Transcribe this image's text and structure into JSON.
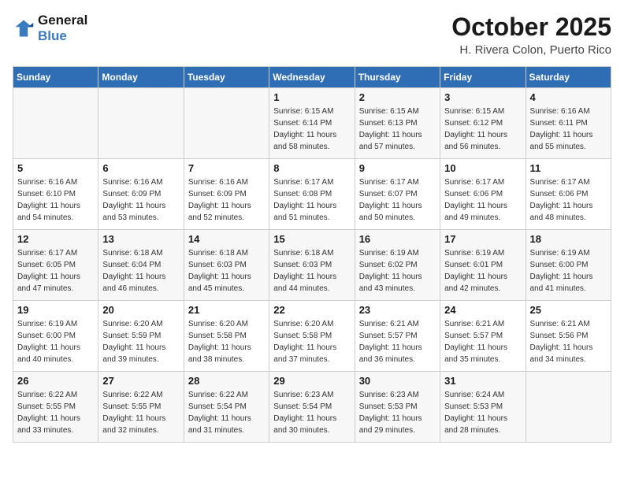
{
  "header": {
    "logo_line1": "General",
    "logo_line2": "Blue",
    "title": "October 2025",
    "subtitle": "H. Rivera Colon, Puerto Rico"
  },
  "weekdays": [
    "Sunday",
    "Monday",
    "Tuesday",
    "Wednesday",
    "Thursday",
    "Friday",
    "Saturday"
  ],
  "weeks": [
    [
      {
        "day": "",
        "sunrise": "",
        "sunset": "",
        "daylight": ""
      },
      {
        "day": "",
        "sunrise": "",
        "sunset": "",
        "daylight": ""
      },
      {
        "day": "",
        "sunrise": "",
        "sunset": "",
        "daylight": ""
      },
      {
        "day": "1",
        "sunrise": "Sunrise: 6:15 AM",
        "sunset": "Sunset: 6:14 PM",
        "daylight": "Daylight: 11 hours and 58 minutes."
      },
      {
        "day": "2",
        "sunrise": "Sunrise: 6:15 AM",
        "sunset": "Sunset: 6:13 PM",
        "daylight": "Daylight: 11 hours and 57 minutes."
      },
      {
        "day": "3",
        "sunrise": "Sunrise: 6:15 AM",
        "sunset": "Sunset: 6:12 PM",
        "daylight": "Daylight: 11 hours and 56 minutes."
      },
      {
        "day": "4",
        "sunrise": "Sunrise: 6:16 AM",
        "sunset": "Sunset: 6:11 PM",
        "daylight": "Daylight: 11 hours and 55 minutes."
      }
    ],
    [
      {
        "day": "5",
        "sunrise": "Sunrise: 6:16 AM",
        "sunset": "Sunset: 6:10 PM",
        "daylight": "Daylight: 11 hours and 54 minutes."
      },
      {
        "day": "6",
        "sunrise": "Sunrise: 6:16 AM",
        "sunset": "Sunset: 6:09 PM",
        "daylight": "Daylight: 11 hours and 53 minutes."
      },
      {
        "day": "7",
        "sunrise": "Sunrise: 6:16 AM",
        "sunset": "Sunset: 6:09 PM",
        "daylight": "Daylight: 11 hours and 52 minutes."
      },
      {
        "day": "8",
        "sunrise": "Sunrise: 6:17 AM",
        "sunset": "Sunset: 6:08 PM",
        "daylight": "Daylight: 11 hours and 51 minutes."
      },
      {
        "day": "9",
        "sunrise": "Sunrise: 6:17 AM",
        "sunset": "Sunset: 6:07 PM",
        "daylight": "Daylight: 11 hours and 50 minutes."
      },
      {
        "day": "10",
        "sunrise": "Sunrise: 6:17 AM",
        "sunset": "Sunset: 6:06 PM",
        "daylight": "Daylight: 11 hours and 49 minutes."
      },
      {
        "day": "11",
        "sunrise": "Sunrise: 6:17 AM",
        "sunset": "Sunset: 6:06 PM",
        "daylight": "Daylight: 11 hours and 48 minutes."
      }
    ],
    [
      {
        "day": "12",
        "sunrise": "Sunrise: 6:17 AM",
        "sunset": "Sunset: 6:05 PM",
        "daylight": "Daylight: 11 hours and 47 minutes."
      },
      {
        "day": "13",
        "sunrise": "Sunrise: 6:18 AM",
        "sunset": "Sunset: 6:04 PM",
        "daylight": "Daylight: 11 hours and 46 minutes."
      },
      {
        "day": "14",
        "sunrise": "Sunrise: 6:18 AM",
        "sunset": "Sunset: 6:03 PM",
        "daylight": "Daylight: 11 hours and 45 minutes."
      },
      {
        "day": "15",
        "sunrise": "Sunrise: 6:18 AM",
        "sunset": "Sunset: 6:03 PM",
        "daylight": "Daylight: 11 hours and 44 minutes."
      },
      {
        "day": "16",
        "sunrise": "Sunrise: 6:19 AM",
        "sunset": "Sunset: 6:02 PM",
        "daylight": "Daylight: 11 hours and 43 minutes."
      },
      {
        "day": "17",
        "sunrise": "Sunrise: 6:19 AM",
        "sunset": "Sunset: 6:01 PM",
        "daylight": "Daylight: 11 hours and 42 minutes."
      },
      {
        "day": "18",
        "sunrise": "Sunrise: 6:19 AM",
        "sunset": "Sunset: 6:00 PM",
        "daylight": "Daylight: 11 hours and 41 minutes."
      }
    ],
    [
      {
        "day": "19",
        "sunrise": "Sunrise: 6:19 AM",
        "sunset": "Sunset: 6:00 PM",
        "daylight": "Daylight: 11 hours and 40 minutes."
      },
      {
        "day": "20",
        "sunrise": "Sunrise: 6:20 AM",
        "sunset": "Sunset: 5:59 PM",
        "daylight": "Daylight: 11 hours and 39 minutes."
      },
      {
        "day": "21",
        "sunrise": "Sunrise: 6:20 AM",
        "sunset": "Sunset: 5:58 PM",
        "daylight": "Daylight: 11 hours and 38 minutes."
      },
      {
        "day": "22",
        "sunrise": "Sunrise: 6:20 AM",
        "sunset": "Sunset: 5:58 PM",
        "daylight": "Daylight: 11 hours and 37 minutes."
      },
      {
        "day": "23",
        "sunrise": "Sunrise: 6:21 AM",
        "sunset": "Sunset: 5:57 PM",
        "daylight": "Daylight: 11 hours and 36 minutes."
      },
      {
        "day": "24",
        "sunrise": "Sunrise: 6:21 AM",
        "sunset": "Sunset: 5:57 PM",
        "daylight": "Daylight: 11 hours and 35 minutes."
      },
      {
        "day": "25",
        "sunrise": "Sunrise: 6:21 AM",
        "sunset": "Sunset: 5:56 PM",
        "daylight": "Daylight: 11 hours and 34 minutes."
      }
    ],
    [
      {
        "day": "26",
        "sunrise": "Sunrise: 6:22 AM",
        "sunset": "Sunset: 5:55 PM",
        "daylight": "Daylight: 11 hours and 33 minutes."
      },
      {
        "day": "27",
        "sunrise": "Sunrise: 6:22 AM",
        "sunset": "Sunset: 5:55 PM",
        "daylight": "Daylight: 11 hours and 32 minutes."
      },
      {
        "day": "28",
        "sunrise": "Sunrise: 6:22 AM",
        "sunset": "Sunset: 5:54 PM",
        "daylight": "Daylight: 11 hours and 31 minutes."
      },
      {
        "day": "29",
        "sunrise": "Sunrise: 6:23 AM",
        "sunset": "Sunset: 5:54 PM",
        "daylight": "Daylight: 11 hours and 30 minutes."
      },
      {
        "day": "30",
        "sunrise": "Sunrise: 6:23 AM",
        "sunset": "Sunset: 5:53 PM",
        "daylight": "Daylight: 11 hours and 29 minutes."
      },
      {
        "day": "31",
        "sunrise": "Sunrise: 6:24 AM",
        "sunset": "Sunset: 5:53 PM",
        "daylight": "Daylight: 11 hours and 28 minutes."
      },
      {
        "day": "",
        "sunrise": "",
        "sunset": "",
        "daylight": ""
      }
    ]
  ]
}
